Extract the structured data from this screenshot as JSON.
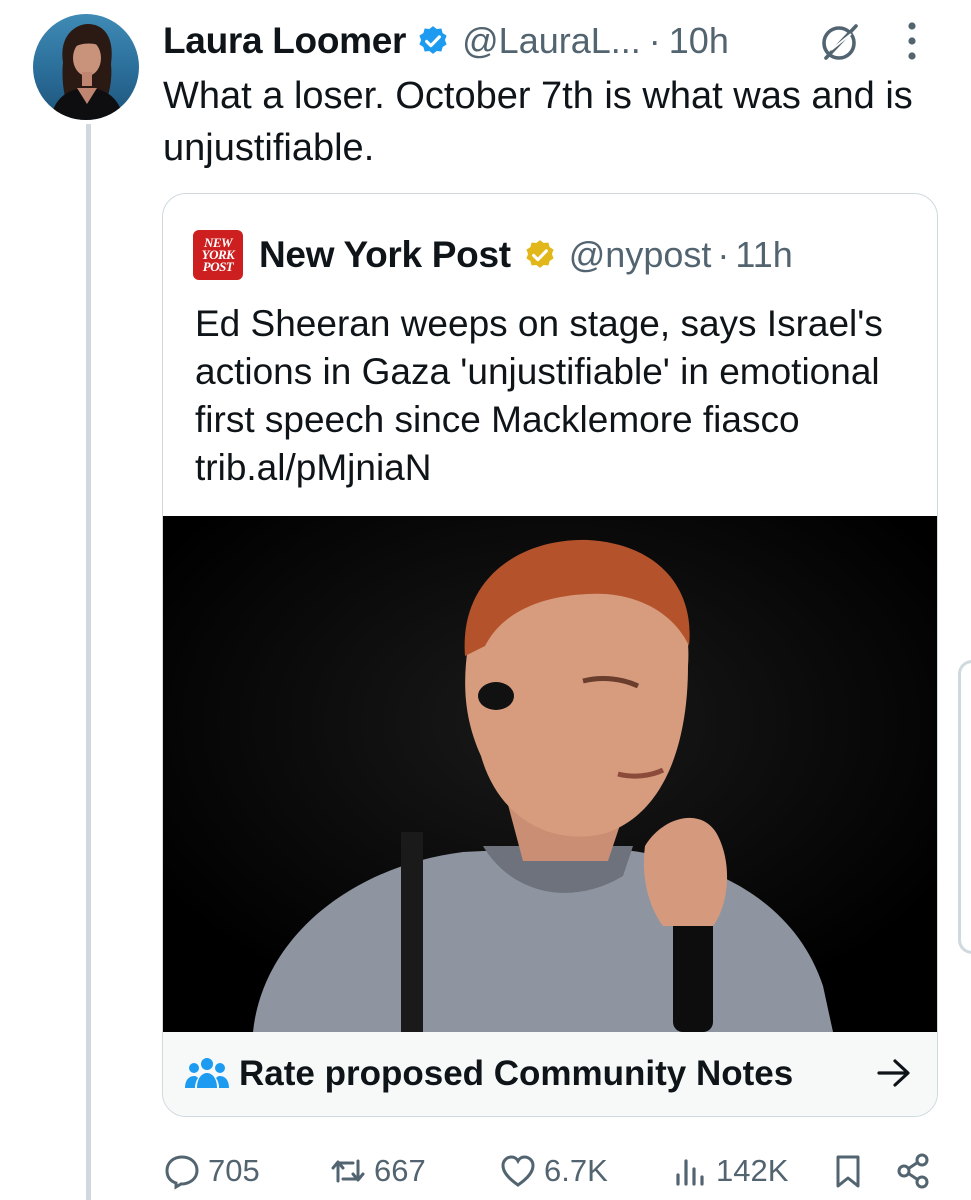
{
  "post": {
    "author_name": "Laura Loomer",
    "author_handle": "@LauraL...",
    "separator": "·",
    "timestamp": "10h",
    "text": "What a loser. October 7th is what was and is unjustifiable.",
    "verified_color": "#1d9bf0"
  },
  "quoted": {
    "logo_lines": [
      "NEW",
      "YORK",
      "POST"
    ],
    "author_name": "New York Post",
    "author_handle": "@nypost",
    "separator": "·",
    "timestamp": "11h",
    "text": "Ed Sheeran weeps on stage, says Israel's actions in Gaza 'unjustifiable' in emotional first speech since Macklemore fiasco trib.al/pMjniaN",
    "badge_color": "#e2b719",
    "logo_color": "#cd1f1f"
  },
  "community_notes": {
    "label": "Rate proposed Community Notes",
    "accent_color": "#1d9bf0"
  },
  "actions": {
    "replies": "705",
    "reposts": "667",
    "likes": "6.7K",
    "views": "142K"
  },
  "icons": [
    "grok-icon",
    "more-icon",
    "reply-icon",
    "repost-icon",
    "like-icon",
    "views-icon",
    "bookmark-icon",
    "share-icon",
    "community-notes-icon",
    "arrow-right-icon"
  ]
}
